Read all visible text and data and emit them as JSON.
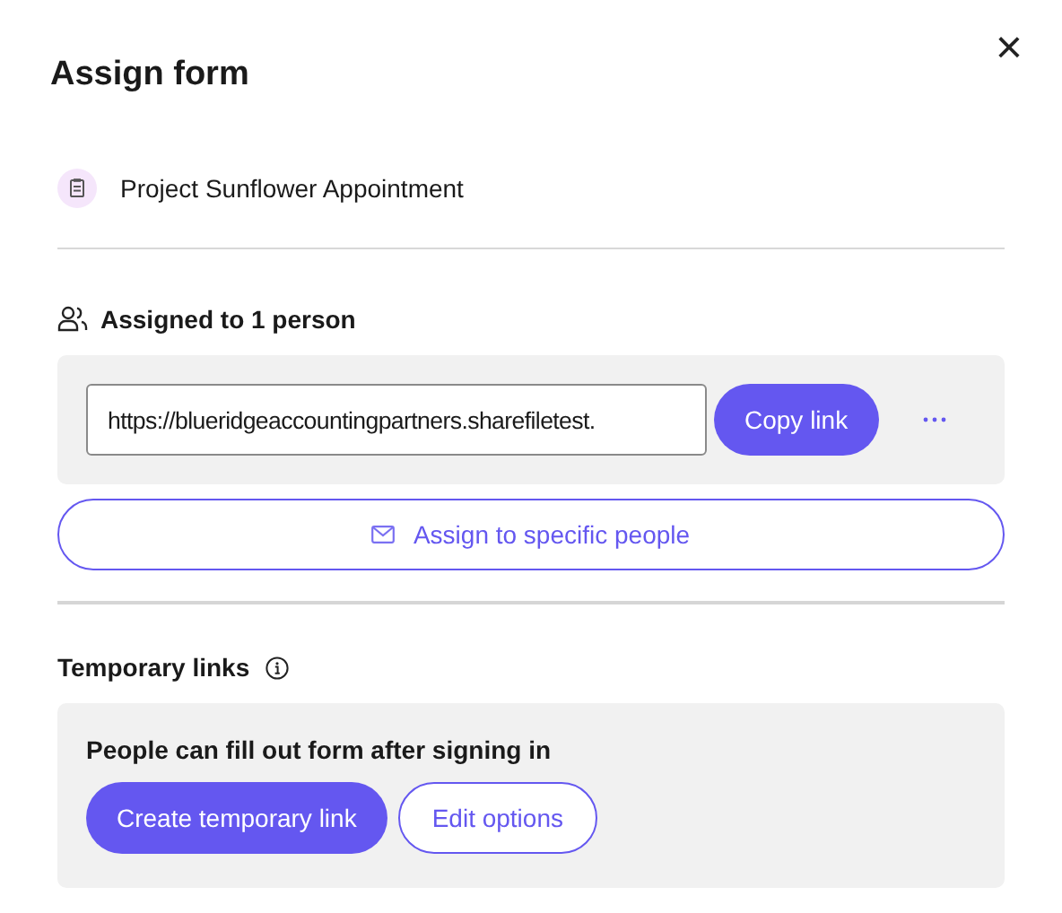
{
  "dialog": {
    "title": "Assign form",
    "close_symbol": "×"
  },
  "form": {
    "name": "Project Sunflower Appointment"
  },
  "assignment": {
    "label": "Assigned to 1 person",
    "link": {
      "value": "https://blueridgeaccountingpartners.sharefiletest."
    },
    "copy_button": "Copy link",
    "assign_button": "Assign to specific people"
  },
  "temporary_links": {
    "title": "Temporary links",
    "description": "People can fill out form after signing in",
    "create_button": "Create temporary link",
    "edit_button": "Edit options"
  }
}
